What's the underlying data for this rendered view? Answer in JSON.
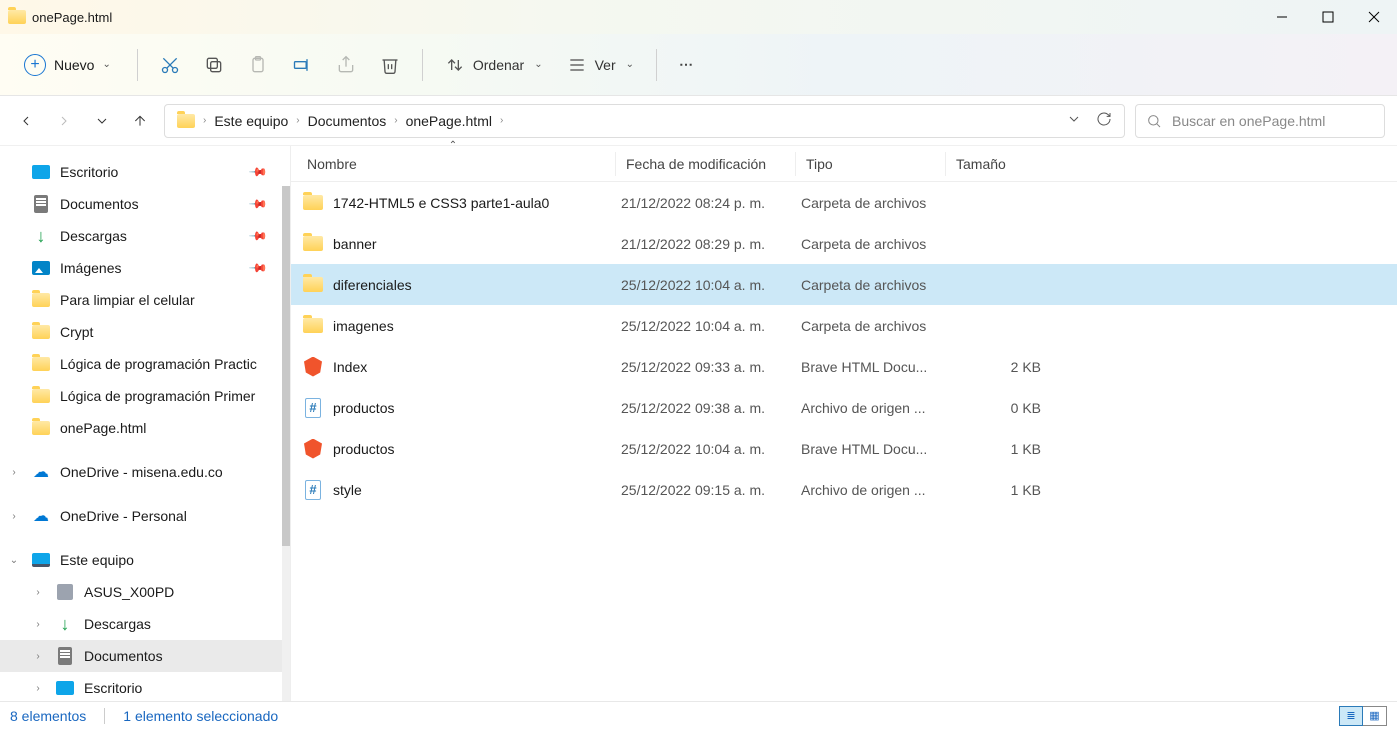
{
  "title": "onePage.html",
  "toolbar": {
    "new": "Nuevo",
    "sort": "Ordenar",
    "view": "Ver"
  },
  "breadcrumbs": [
    "Este equipo",
    "Documentos",
    "onePage.html"
  ],
  "search_placeholder": "Buscar en onePage.html",
  "columns": {
    "name": "Nombre",
    "date": "Fecha de modificación",
    "type": "Tipo",
    "size": "Tamaño"
  },
  "sidebar": {
    "quick": [
      {
        "icon": "desktop",
        "label": "Escritorio",
        "pinned": true
      },
      {
        "icon": "doc",
        "label": "Documentos",
        "pinned": true
      },
      {
        "icon": "download",
        "label": "Descargas",
        "pinned": true
      },
      {
        "icon": "image",
        "label": "Imágenes",
        "pinned": true
      },
      {
        "icon": "folder",
        "label": "Para limpiar el celular",
        "pinned": false
      },
      {
        "icon": "folder",
        "label": "Crypt",
        "pinned": false
      },
      {
        "icon": "folder",
        "label": "Lógica de programación Practic",
        "pinned": false
      },
      {
        "icon": "folder",
        "label": "Lógica de programación Primer",
        "pinned": false
      },
      {
        "icon": "folder",
        "label": "onePage.html",
        "pinned": false
      }
    ],
    "onedrive1": "OneDrive - misena.edu.co",
    "onedrive2": "OneDrive - Personal",
    "thispc": "Este equipo",
    "pc_children": [
      {
        "icon": "drive",
        "label": "ASUS_X00PD"
      },
      {
        "icon": "download",
        "label": "Descargas"
      },
      {
        "icon": "doc",
        "label": "Documentos",
        "selected": true
      },
      {
        "icon": "desktop",
        "label": "Escritorio"
      }
    ]
  },
  "files": [
    {
      "icon": "folder",
      "name": "1742-HTML5 e CSS3 parte1-aula0",
      "date": "21/12/2022 08:24 p. m.",
      "type": "Carpeta de archivos",
      "size": ""
    },
    {
      "icon": "folder",
      "name": "banner",
      "date": "21/12/2022 08:29 p. m.",
      "type": "Carpeta de archivos",
      "size": ""
    },
    {
      "icon": "folder",
      "name": "diferenciales",
      "date": "25/12/2022 10:04 a. m.",
      "type": "Carpeta de archivos",
      "size": "",
      "selected": true
    },
    {
      "icon": "folder",
      "name": "imagenes",
      "date": "25/12/2022 10:04 a. m.",
      "type": "Carpeta de archivos",
      "size": ""
    },
    {
      "icon": "brave",
      "name": "Index",
      "date": "25/12/2022 09:33 a. m.",
      "type": "Brave HTML Docu...",
      "size": "2 KB"
    },
    {
      "icon": "css",
      "name": "productos",
      "date": "25/12/2022 09:38 a. m.",
      "type": "Archivo de origen ...",
      "size": "0 KB"
    },
    {
      "icon": "brave",
      "name": "productos",
      "date": "25/12/2022 10:04 a. m.",
      "type": "Brave HTML Docu...",
      "size": "1 KB"
    },
    {
      "icon": "css",
      "name": "style",
      "date": "25/12/2022 09:15 a. m.",
      "type": "Archivo de origen ...",
      "size": "1 KB"
    }
  ],
  "status": {
    "items": "8 elementos",
    "selected": "1 elemento seleccionado"
  }
}
